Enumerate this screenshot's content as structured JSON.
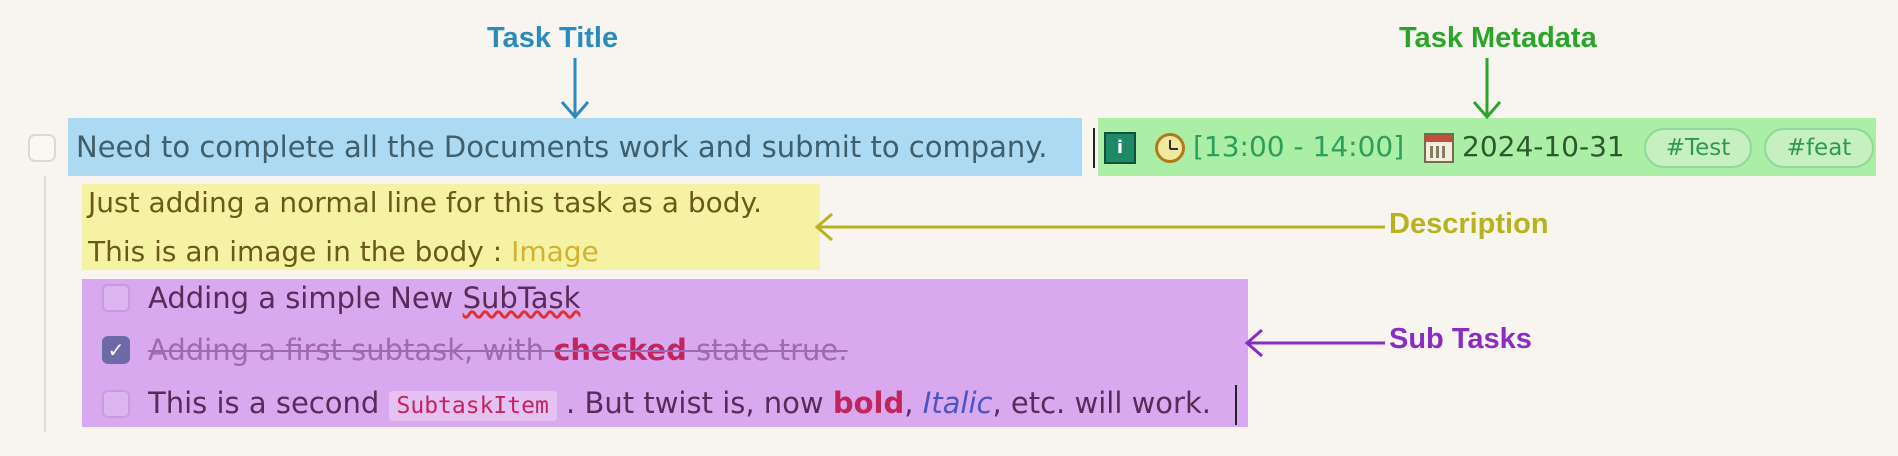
{
  "annotations": {
    "task_title": "Task Title",
    "task_metadata": "Task Metadata",
    "description": "Description",
    "sub_tasks": "Sub Tasks"
  },
  "task": {
    "title": "Need to complete all the Documents work  and submit to company.",
    "metadata": {
      "time": "[13:00 - 14:00]",
      "date": "2024-10-31",
      "tags": [
        "#Test",
        "#feat"
      ]
    },
    "description": {
      "line1": "Just adding a normal line for this task as a body.",
      "line2_prefix": "This is an image in the body : ",
      "line2_link": "Image"
    },
    "subtasks": [
      {
        "checked": false,
        "prefix": "Adding a simple New ",
        "misspelled": "SubTask"
      },
      {
        "checked": true,
        "prefix": "Adding a first subtask, with ",
        "bold": "checked",
        "suffix": " state true."
      },
      {
        "checked": false,
        "prefix": "This is a second ",
        "code": "SubtaskItem",
        "mid": " . But twist is, now ",
        "bold": "bold",
        "comma1": ", ",
        "italic": "Italic",
        "suffix": ", etc. will work."
      }
    ]
  },
  "colors": {
    "title_highlight": "#acdaf2",
    "metadata_highlight": "#abeea6",
    "description_highlight": "#f5f3a3",
    "subtasks_highlight": "#d8a9ef"
  },
  "icons": [
    "info-icon",
    "alarm-clock-icon",
    "calendar-icon",
    "checkmark-icon"
  ]
}
